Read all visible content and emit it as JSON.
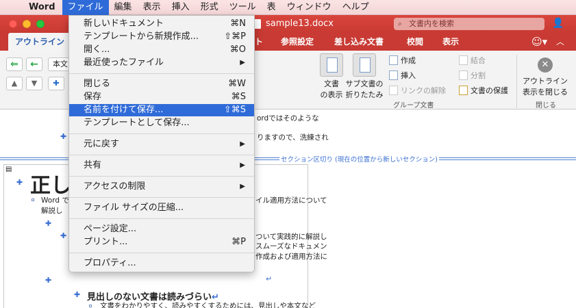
{
  "menubar": {
    "app": "Word",
    "items": [
      "ファイル",
      "編集",
      "表示",
      "挿入",
      "形式",
      "ツール",
      "表",
      "ウィンドウ",
      "ヘルプ"
    ]
  },
  "window": {
    "title": "sample13.docx",
    "search_placeholder": "文書内を検索"
  },
  "ribbon": {
    "tabs": {
      "outline": "アウトライン",
      "t": "ト",
      "references": "参照設定",
      "mailings": "差し込み文書",
      "review": "校閲",
      "view": "表示"
    },
    "style_box": "本文",
    "doc_show": [
      "文書",
      "の表示"
    ],
    "subdoc_fold": [
      "サブ文書の",
      "折りたたみ"
    ],
    "create": "作成",
    "insert": "挿入",
    "unlink": "リンクの解除",
    "merge": "結合",
    "split": "分割",
    "lock_doc": "文書の保護",
    "group_doc_label": "グループ文書",
    "close_outline": [
      "アウトライン",
      "表示を閉じる"
    ],
    "group_close_label": "閉じる"
  },
  "file_menu": {
    "new_doc": {
      "label": "新しいドキュメント",
      "shortcut": "⌘N"
    },
    "new_template": {
      "label": "テンプレートから新規作成...",
      "shortcut": "⇧⌘P"
    },
    "open": {
      "label": "開く...",
      "shortcut": "⌘O"
    },
    "recent": {
      "label": "最近使ったファイル"
    },
    "close": {
      "label": "閉じる",
      "shortcut": "⌘W"
    },
    "save": {
      "label": "保存",
      "shortcut": "⌘S"
    },
    "save_as": {
      "label": "名前を付けて保存...",
      "shortcut": "⇧⌘S"
    },
    "save_template": {
      "label": "テンプレートとして保存..."
    },
    "revert": {
      "label": "元に戻す"
    },
    "share": {
      "label": "共有"
    },
    "restrict": {
      "label": "アクセスの制限"
    },
    "compress": {
      "label": "ファイル サイズの圧縮..."
    },
    "page_setup": {
      "label": "ページ設定..."
    },
    "print": {
      "label": "プリント...",
      "shortcut": "⌘P"
    },
    "properties": {
      "label": "プロパティ..."
    }
  },
  "document": {
    "line1": "ordではそのような",
    "line2": "りますので、洗練され",
    "section_break": "セクション区切り (現在の位置から新しいセクション)",
    "heading_fragment": "正し",
    "para1_a": "Word で",
    "para1_b": "イル適用方法について",
    "para1_c": "解説し",
    "para2_a": "ついて実践的に解説し",
    "para2_b": "スムーズなドキュメン",
    "para2_c": "作成および適用方法に",
    "subheading": "見出しのない文書は読みづらい",
    "sub_para": "文書をわかりやすく、読みやすくするためには、見出しや本文など"
  }
}
